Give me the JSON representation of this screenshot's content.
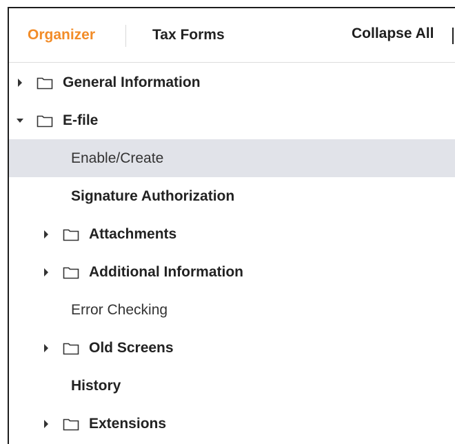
{
  "tabs": [
    {
      "label": "Organizer",
      "active": true
    },
    {
      "label": "Tax Forms",
      "active": false
    }
  ],
  "actions": {
    "collapse_all": "Collapse All"
  },
  "colors": {
    "active_tab": "#f28c28",
    "selected_row": "#e1e3e9",
    "text": "#222222"
  },
  "tree": [
    {
      "label": "General Information",
      "type": "folder",
      "expanded": false,
      "level": 0
    },
    {
      "label": "E-file",
      "type": "folder",
      "expanded": true,
      "level": 0
    },
    {
      "label": "Enable/Create",
      "type": "item",
      "weight": "normal",
      "selected": true,
      "level": 1
    },
    {
      "label": "Signature Authorization",
      "type": "item",
      "weight": "bold",
      "level": 1
    },
    {
      "label": "Attachments",
      "type": "folder",
      "expanded": false,
      "level": 1
    },
    {
      "label": "Additional Information",
      "type": "folder",
      "expanded": false,
      "level": 1
    },
    {
      "label": "Error Checking",
      "type": "item",
      "weight": "normal",
      "level": 1
    },
    {
      "label": "Old Screens",
      "type": "folder",
      "expanded": false,
      "level": 1
    },
    {
      "label": "History",
      "type": "item",
      "weight": "bold",
      "level": 1
    },
    {
      "label": "Extensions",
      "type": "folder",
      "expanded": false,
      "level": 1
    }
  ]
}
